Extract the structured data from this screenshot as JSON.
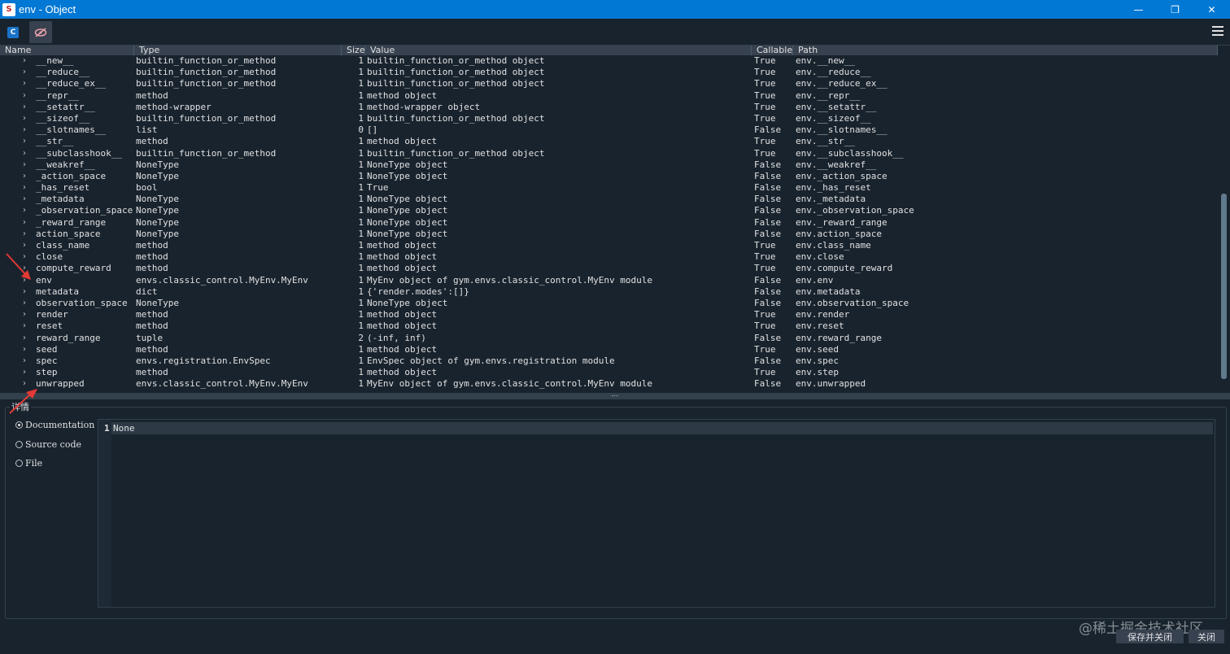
{
  "window": {
    "title": "env - Object",
    "app_icon_glyph": "S",
    "minimize": "—",
    "maximize": "❐",
    "close": "✕"
  },
  "toolbar": {
    "code_button_icon": "code-icon",
    "hide_button_icon": "eye-off-icon",
    "menu_icon": "hamburger-menu-icon"
  },
  "table": {
    "headers": [
      "Name",
      "Type",
      "Size",
      "Value",
      "Callable",
      "Path"
    ],
    "rows": [
      {
        "name": "__new__",
        "type": "builtin_function_or_method",
        "size": "1",
        "value": "builtin_function_or_method object",
        "callable": "True",
        "path": "env.__new__"
      },
      {
        "name": "__reduce__",
        "type": "builtin_function_or_method",
        "size": "1",
        "value": "builtin_function_or_method object",
        "callable": "True",
        "path": "env.__reduce__"
      },
      {
        "name": "__reduce_ex__",
        "type": "builtin_function_or_method",
        "size": "1",
        "value": "builtin_function_or_method object",
        "callable": "True",
        "path": "env.__reduce_ex__"
      },
      {
        "name": "__repr__",
        "type": "method",
        "size": "1",
        "value": "method object",
        "callable": "True",
        "path": "env.__repr__"
      },
      {
        "name": "__setattr__",
        "type": "method-wrapper",
        "size": "1",
        "value": "method-wrapper object",
        "callable": "True",
        "path": "env.__setattr__"
      },
      {
        "name": "__sizeof__",
        "type": "builtin_function_or_method",
        "size": "1",
        "value": "builtin_function_or_method object",
        "callable": "True",
        "path": "env.__sizeof__"
      },
      {
        "name": "__slotnames__",
        "type": "list",
        "size": "0",
        "value": "[]",
        "callable": "False",
        "path": "env.__slotnames__"
      },
      {
        "name": "__str__",
        "type": "method",
        "size": "1",
        "value": "method object",
        "callable": "True",
        "path": "env.__str__"
      },
      {
        "name": "__subclasshook__",
        "type": "builtin_function_or_method",
        "size": "1",
        "value": "builtin_function_or_method object",
        "callable": "True",
        "path": "env.__subclasshook__"
      },
      {
        "name": "__weakref__",
        "type": "NoneType",
        "size": "1",
        "value": "NoneType object",
        "callable": "False",
        "path": "env.__weakref__"
      },
      {
        "name": "_action_space",
        "type": "NoneType",
        "size": "1",
        "value": "NoneType object",
        "callable": "False",
        "path": "env._action_space"
      },
      {
        "name": "_has_reset",
        "type": "bool",
        "size": "1",
        "value": "True",
        "callable": "False",
        "path": "env._has_reset"
      },
      {
        "name": "_metadata",
        "type": "NoneType",
        "size": "1",
        "value": "NoneType object",
        "callable": "False",
        "path": "env._metadata"
      },
      {
        "name": "_observation_space",
        "type": "NoneType",
        "size": "1",
        "value": "NoneType object",
        "callable": "False",
        "path": "env._observation_space"
      },
      {
        "name": "_reward_range",
        "type": "NoneType",
        "size": "1",
        "value": "NoneType object",
        "callable": "False",
        "path": "env._reward_range"
      },
      {
        "name": "action_space",
        "type": "NoneType",
        "size": "1",
        "value": "NoneType object",
        "callable": "False",
        "path": "env.action_space"
      },
      {
        "name": "class_name",
        "type": "method",
        "size": "1",
        "value": "method object",
        "callable": "True",
        "path": "env.class_name"
      },
      {
        "name": "close",
        "type": "method",
        "size": "1",
        "value": "method object",
        "callable": "True",
        "path": "env.close"
      },
      {
        "name": "compute_reward",
        "type": "method",
        "size": "1",
        "value": "method object",
        "callable": "True",
        "path": "env.compute_reward"
      },
      {
        "name": "env",
        "type": "envs.classic_control.MyEnv.MyEnv",
        "size": "1",
        "value": "MyEnv object of gym.envs.classic_control.MyEnv module",
        "callable": "False",
        "path": "env.env"
      },
      {
        "name": "metadata",
        "type": "dict",
        "size": "1",
        "value": "{'render.modes':[]}",
        "callable": "False",
        "path": "env.metadata"
      },
      {
        "name": "observation_space",
        "type": "NoneType",
        "size": "1",
        "value": "NoneType object",
        "callable": "False",
        "path": "env.observation_space"
      },
      {
        "name": "render",
        "type": "method",
        "size": "1",
        "value": "method object",
        "callable": "True",
        "path": "env.render"
      },
      {
        "name": "reset",
        "type": "method",
        "size": "1",
        "value": "method object",
        "callable": "True",
        "path": "env.reset"
      },
      {
        "name": "reward_range",
        "type": "tuple",
        "size": "2",
        "value": "(-inf, inf)",
        "callable": "False",
        "path": "env.reward_range"
      },
      {
        "name": "seed",
        "type": "method",
        "size": "1",
        "value": "method object",
        "callable": "True",
        "path": "env.seed"
      },
      {
        "name": "spec",
        "type": "envs.registration.EnvSpec",
        "size": "1",
        "value": "EnvSpec object of gym.envs.registration module",
        "callable": "False",
        "path": "env.spec"
      },
      {
        "name": "step",
        "type": "method",
        "size": "1",
        "value": "method object",
        "callable": "True",
        "path": "env.step"
      },
      {
        "name": "unwrapped",
        "type": "envs.classic_control.MyEnv.MyEnv",
        "size": "1",
        "value": "MyEnv object of gym.envs.classic_control.MyEnv module",
        "callable": "False",
        "path": "env.unwrapped"
      }
    ],
    "expand_glyph": "›"
  },
  "details": {
    "title": "详情",
    "options": [
      {
        "label": "Documentation",
        "selected": true
      },
      {
        "label": "Source code",
        "selected": false
      },
      {
        "label": "File",
        "selected": false
      }
    ],
    "line_number": "1",
    "content": "None"
  },
  "footer": {
    "save_close_label": "保存并关闭",
    "close_label": "关闭"
  },
  "watermark": "@稀土掘金技术社区",
  "colors": {
    "titlebar": "#0078d4",
    "background": "#19232d",
    "annotation_arrow": "#e53935"
  }
}
